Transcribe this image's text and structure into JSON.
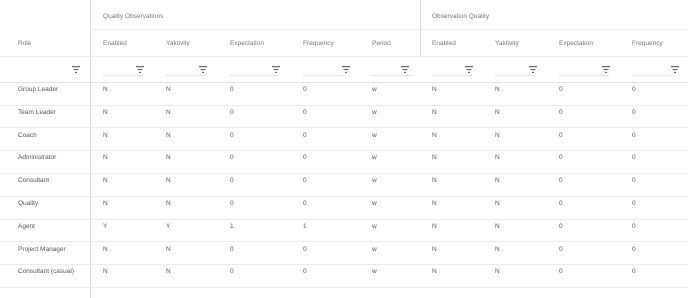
{
  "groups": {
    "quality_observations": "Quality Observations",
    "observation_quality": "Observation Quality"
  },
  "columns": [
    "Role",
    "Enabled",
    "Yaktivity",
    "Expectation",
    "Frequency",
    "Period",
    "Enabled",
    "Yaktivity",
    "Expectation",
    "Frequency"
  ],
  "icons": {
    "filter": "filter-icon"
  },
  "rows": [
    [
      "Group Leader",
      "N",
      "N",
      "0",
      "0",
      "w",
      "N",
      "N",
      "0",
      "0"
    ],
    [
      "Team Leader",
      "N",
      "N",
      "0",
      "0",
      "w",
      "N",
      "N",
      "0",
      "0"
    ],
    [
      "Coach",
      "N",
      "N",
      "0",
      "0",
      "w",
      "N",
      "N",
      "0",
      "0"
    ],
    [
      "Administrator",
      "N",
      "N",
      "0",
      "0",
      "w",
      "N",
      "N",
      "0",
      "0"
    ],
    [
      "Consultant",
      "N",
      "N",
      "0",
      "0",
      "w",
      "N",
      "N",
      "0",
      "0"
    ],
    [
      "Quality",
      "N",
      "N",
      "0",
      "0",
      "w",
      "N",
      "N",
      "0",
      "0"
    ],
    [
      "Agent",
      "Y",
      "Y",
      "1",
      "1",
      "w",
      "N",
      "N",
      "0",
      "0"
    ],
    [
      "Project Manager",
      "N",
      "N",
      "0",
      "0",
      "w",
      "N",
      "N",
      "0",
      "0"
    ],
    [
      "Consultant (casual)",
      "N",
      "N",
      "0",
      "0",
      "w",
      "N",
      "N",
      "0",
      "0"
    ]
  ]
}
